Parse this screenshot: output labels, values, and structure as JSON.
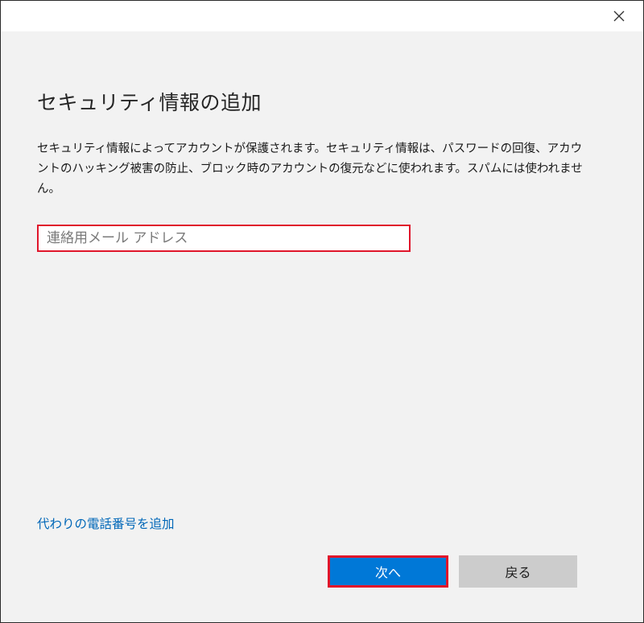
{
  "dialog": {
    "heading": "セキュリティ情報の追加",
    "description": "セキュリティ情報によってアカウントが保護されます。セキュリティ情報は、パスワードの回復、アカウントのハッキング被害の防止、ブロック時のアカウントの復元などに使われます。スパムには使われません。",
    "email_input": {
      "value": "",
      "placeholder": "連絡用メール アドレス"
    },
    "alt_phone_link": "代わりの電話番号を追加",
    "next_button": "次へ",
    "back_button": "戻る"
  },
  "colors": {
    "dialog_background": "#f2f2f2",
    "primary_button": "#0078d7",
    "secondary_button": "#cccccc",
    "link": "#0067b8",
    "highlight_border": "#e0162b"
  },
  "icons": {
    "close": "close-icon"
  }
}
